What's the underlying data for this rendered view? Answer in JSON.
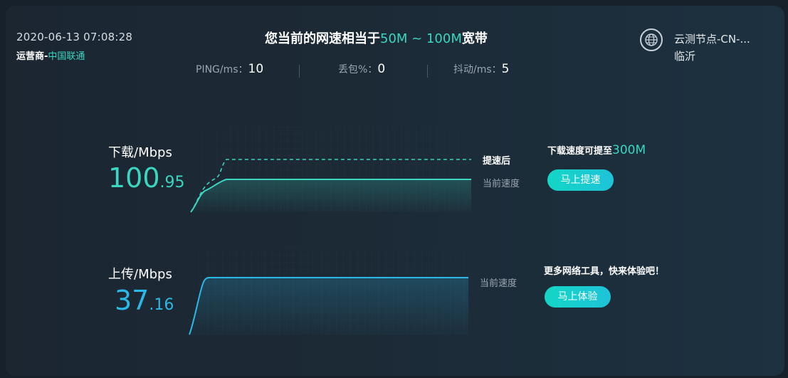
{
  "header": {
    "timestamp": "2020-06-13 07:08:28",
    "isp_prefix": "运营商-",
    "isp_name": "中国联通",
    "headline_prefix": "您当前的网速相当于",
    "headline_range": "50M ~ 100M",
    "headline_suffix": "宽带"
  },
  "stats": [
    {
      "label": "PING/ms：",
      "value": "10"
    },
    {
      "label": "丢包%：",
      "value": "0"
    },
    {
      "label": "抖动/ms：",
      "value": "5"
    }
  ],
  "node": {
    "icon": "globe-icon",
    "line1": "云测节点-CN-...",
    "line2": "临沂"
  },
  "download": {
    "label": "下载/Mbps",
    "value_int": "100",
    "value_dec": ".95",
    "tag_after": "提速后",
    "tag_current": "当前速度",
    "promo_prefix": "下载速度可提至",
    "promo_value": "300M",
    "button": "马上提速"
  },
  "upload": {
    "label": "上传/Mbps",
    "value_int": "37",
    "value_dec": ".16",
    "tag_current": "当前速度",
    "promo": "更多网络工具，快来体验吧！",
    "button": "马上体验"
  },
  "colors": {
    "download": "#3ad6c0",
    "upload": "#2bb8e6",
    "button": "#13d6c6"
  }
}
